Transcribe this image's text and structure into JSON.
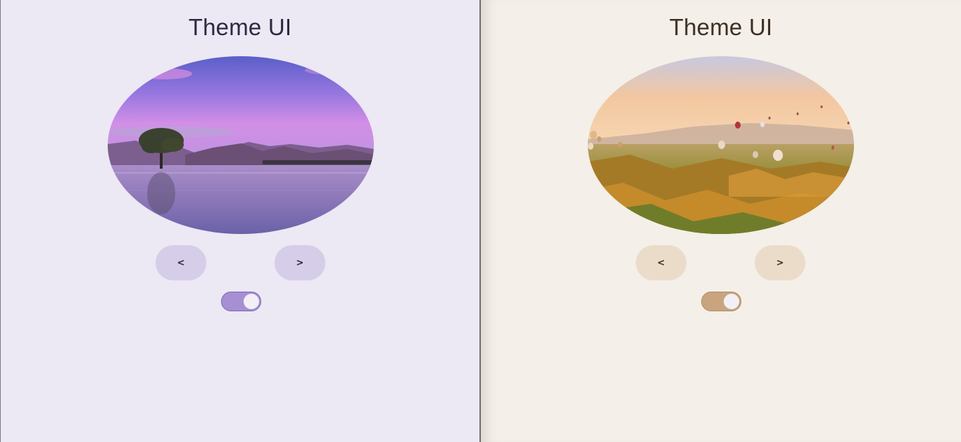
{
  "panels": [
    {
      "theme": "purple",
      "title": "Theme UI",
      "prev_label": "<",
      "next_label": ">",
      "toggle_on": true,
      "image_icon": "lake-tree-photo",
      "colors": {
        "background": "#ece8f4",
        "accent": "#a68fd2",
        "button": "#d6cde8"
      }
    },
    {
      "theme": "sand",
      "title": "Theme UI",
      "prev_label": "<",
      "next_label": ">",
      "toggle_on": true,
      "image_icon": "hot-air-balloons-photo",
      "colors": {
        "background": "#f4efe8",
        "accent": "#c9a57f",
        "button": "#ebdcca"
      }
    }
  ]
}
